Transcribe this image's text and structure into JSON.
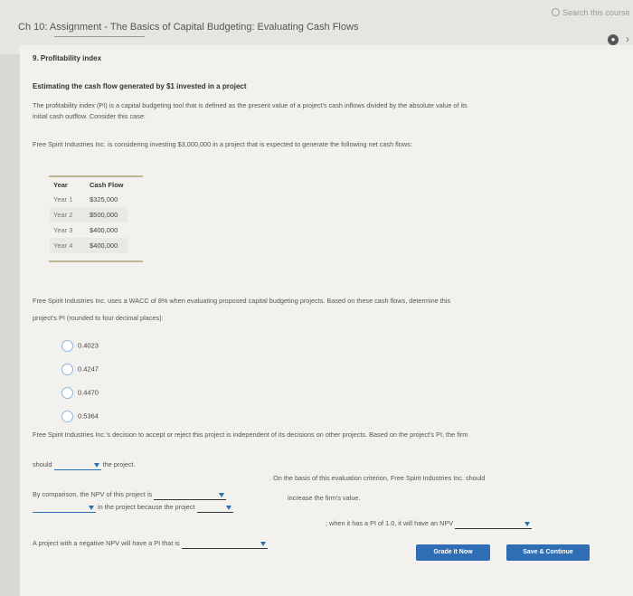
{
  "header": {
    "search_placeholder": "Search this course",
    "assignment_title": "Ch 10: Assignment - The Basics of Capital Budgeting: Evaluating Cash Flows"
  },
  "question": {
    "number_title": "9. Profitability index",
    "subheading": "Estimating the cash flow generated by $1 invested in a project",
    "definition_line1": "The profitability index (PI) is a capital budgeting tool that is defined as the present value of a project's cash inflows divided by the absolute value of its",
    "definition_line2": "initial cash outflow. Consider this case:",
    "case_text": "Free Spirit Industries Inc. is considering investing $3,000,000 in a project that is expected to generate the following net cash flows:",
    "table": {
      "headers": [
        "Year",
        "Cash Flow"
      ],
      "rows": [
        {
          "year": "Year 1",
          "cash": "$325,000"
        },
        {
          "year": "Year 2",
          "cash": "$500,000"
        },
        {
          "year": "Year 3",
          "cash": "$400,000"
        },
        {
          "year": "Year 4",
          "cash": "$400,000"
        }
      ]
    },
    "wacc_line1": "Free Spirit Industries Inc. uses a WACC of 8% when evaluating proposed capital budgeting projects. Based on these cash flows, determine this",
    "wacc_line2": "project's PI (rounded to four decimal places):",
    "options": [
      "0.4023",
      "0.4247",
      "0.4470",
      "0.5364"
    ],
    "decision_line1": "Free Spirit Industries Inc.'s decision to accept or reject this project is independent of its decisions on other projects. Based on the project's PI, the firm",
    "should": "should",
    "the_project": "the project.",
    "npv_comparison": "By comparison, the NPV of this project is",
    "on_basis": ". On the basis of this evaluation criterion, Free Spirit Industries Inc. should",
    "in_project_because": "in the project because the project",
    "increase_value": "increase the firm's value.",
    "negative_npv": "A project with a negative NPV will have a PI that is",
    "pi_one": "; when it has a PI of 1.0, it will have an NPV"
  },
  "buttons": {
    "grade": "Grade It Now",
    "save": "Save & Continue"
  }
}
